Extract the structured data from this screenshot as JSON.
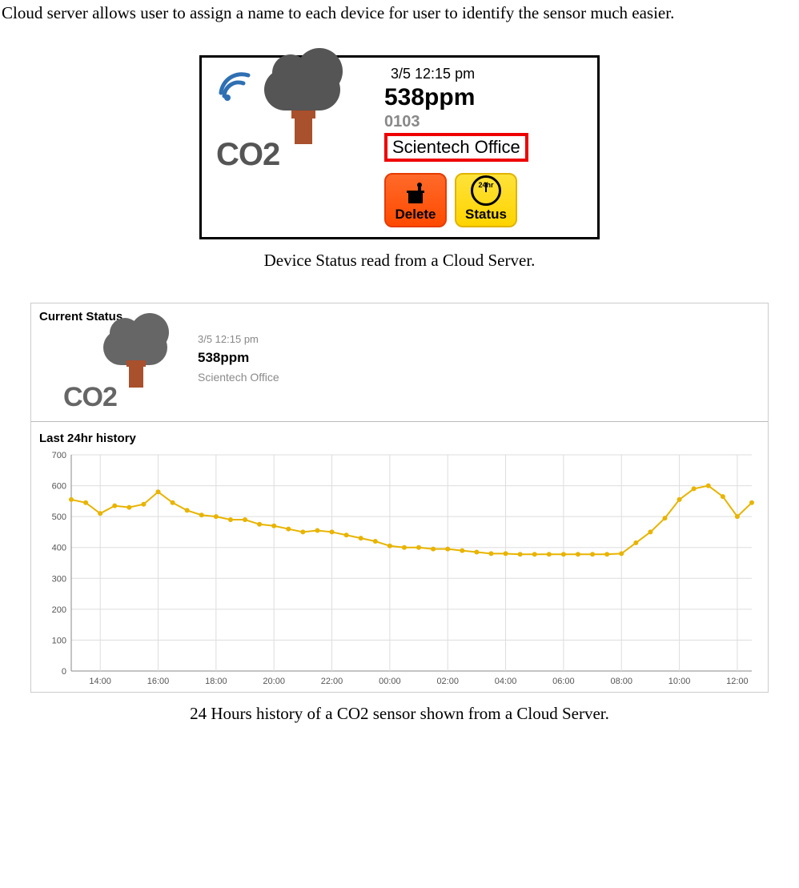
{
  "intro": "Cloud server allows user to assign a name to each device for user to identify the sensor much easier.",
  "device_card": {
    "timestamp": "3/5 12:15 pm",
    "reading": "538ppm",
    "device_id": "0103",
    "device_name": "Scientech Office",
    "co2_label": "CO2",
    "buttons": {
      "delete_label": "Delete",
      "status_label": "Status",
      "status_icon_text": "24hr"
    }
  },
  "caption1": "Device Status read from a Cloud Server.",
  "status_panel": {
    "section_current": "Current Status",
    "timestamp": "3/5 12:15 pm",
    "reading": "538ppm",
    "device_name": "Scientech Office",
    "co2_label": "CO2",
    "section_history": "Last 24hr history"
  },
  "caption2": "24 Hours history of a CO2 sensor shown from a Cloud Server.",
  "chart_data": {
    "type": "line",
    "title": "",
    "xlabel": "",
    "ylabel": "",
    "ylim": [
      0,
      700
    ],
    "y_ticks": [
      0,
      100,
      200,
      300,
      400,
      500,
      600,
      700
    ],
    "x_ticks": [
      "14:00",
      "16:00",
      "18:00",
      "20:00",
      "22:00",
      "00:00",
      "02:00",
      "04:00",
      "06:00",
      "08:00",
      "10:00",
      "12:00"
    ],
    "x": [
      "13:00",
      "13:30",
      "14:00",
      "14:30",
      "15:00",
      "15:30",
      "16:00",
      "16:30",
      "17:00",
      "17:30",
      "18:00",
      "18:30",
      "19:00",
      "19:30",
      "20:00",
      "20:30",
      "21:00",
      "21:30",
      "22:00",
      "22:30",
      "23:00",
      "23:30",
      "00:00",
      "00:30",
      "01:00",
      "01:30",
      "02:00",
      "02:30",
      "03:00",
      "03:30",
      "04:00",
      "04:30",
      "05:00",
      "05:30",
      "06:00",
      "06:30",
      "07:00",
      "07:30",
      "08:00",
      "08:30",
      "09:00",
      "09:30",
      "10:00",
      "10:30",
      "11:00",
      "11:30",
      "12:00",
      "12:30"
    ],
    "values": [
      555,
      545,
      510,
      535,
      530,
      540,
      580,
      545,
      520,
      505,
      500,
      490,
      490,
      475,
      470,
      460,
      450,
      455,
      450,
      440,
      430,
      420,
      405,
      400,
      400,
      395,
      395,
      390,
      385,
      380,
      380,
      378,
      378,
      378,
      378,
      378,
      378,
      378,
      380,
      415,
      450,
      495,
      555,
      590,
      600,
      565,
      500,
      545
    ]
  }
}
